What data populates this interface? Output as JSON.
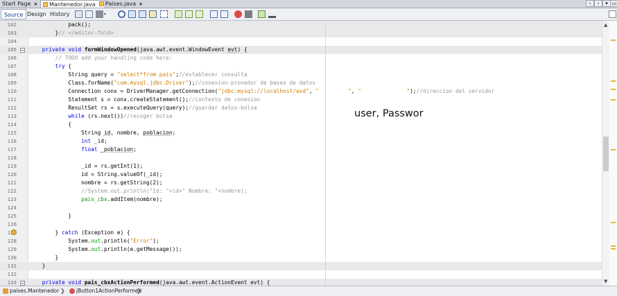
{
  "tabs": [
    {
      "label": "Start Page",
      "close": "×"
    },
    {
      "label": "Mantenedor.java",
      "close": "×"
    },
    {
      "label": "Paises.java",
      "close": "×"
    }
  ],
  "tab_nav": {
    "left": "‹",
    "right": "›",
    "menu": "▾",
    "restore": "▭"
  },
  "editor_tabs": {
    "source": "Source",
    "design": "Design",
    "history": "History"
  },
  "lines": [
    {
      "n": "102",
      "hl": true,
      "html": "            pack();"
    },
    {
      "n": "103",
      "hl": true,
      "html": "        }<span class=\"cm\">// &lt;/editor-fold&gt;</span>"
    },
    {
      "n": "104",
      "hl": false,
      "html": ""
    },
    {
      "n": "105",
      "hl": true,
      "fold": true,
      "html": "    <span class=\"kw\">private void</span> <span class=\"fn\">formWindowOpened</span>(java.awt.event.WindowEvent <span class=\"ul\">evt</span>) {"
    },
    {
      "n": "106",
      "hl": false,
      "html": "        <span class=\"cm\">// TODO add your handling code here:</span>"
    },
    {
      "n": "107",
      "hl": false,
      "html": "        <span class=\"kw\">try</span> {"
    },
    {
      "n": "108",
      "hl": false,
      "html": "            String query = <span class=\"str\">\"select*from pais\"</span>;<span class=\"cm\">//establecer consulta</span>"
    },
    {
      "n": "109",
      "hl": false,
      "html": "            Class.forName(<span class=\"str\">\"com.mysql.jdbc.Driver\"</span>);<span class=\"cm\">//conexion-provedor de bases de datos</span>"
    },
    {
      "n": "110",
      "hl": false,
      "html": "            Connection conx = DriverManager.getConnection(<span class=\"str\">\"jdbc:mysql://localhost/asd\"</span>, <span class=\"str\">\"         \"</span>, <span class=\"str\">\"              \"</span>);<span class=\"cm\">//direccion del servidor</span>"
    },
    {
      "n": "111",
      "hl": false,
      "html": "            Statement s = conx.createStatement();<span class=\"cm\">//contexto de conexion</span>"
    },
    {
      "n": "112",
      "hl": false,
      "html": "            ResultSet rs = s.executeQuery(query);<span class=\"cm\">//guardar datos-bolsa</span>"
    },
    {
      "n": "113",
      "hl": false,
      "html": "            <span class=\"kw\">while</span> (rs.next())<span class=\"cm\">//recoger bolsa</span>"
    },
    {
      "n": "114",
      "hl": false,
      "html": "            {"
    },
    {
      "n": "115",
      "hl": false,
      "html": "                String <span class=\"ul\">id</span>, nombre, <span class=\"ul\">poblacion</span>;"
    },
    {
      "n": "116",
      "hl": false,
      "html": "                <span class=\"kw\">int</span> _id;"
    },
    {
      "n": "117",
      "hl": false,
      "html": "                <span class=\"kw\">float</span> <span class=\"ul\">_poblacion</span>;"
    },
    {
      "n": "118",
      "hl": false,
      "html": ""
    },
    {
      "n": "119",
      "hl": false,
      "html": "                _id = rs.getInt(1);"
    },
    {
      "n": "120",
      "hl": false,
      "html": "                id = String.valueOf(_id);"
    },
    {
      "n": "121",
      "hl": false,
      "html": "                nombre = rs.getString(2);"
    },
    {
      "n": "122",
      "hl": false,
      "html": "                <span class=\"cm\">//System.out.println(\"Id: \"+id+\" Nombre: \"+nombre);</span>"
    },
    {
      "n": "123",
      "hl": false,
      "html": "                <span class=\"fld\">pais_cbx</span>.addItem(nombre);"
    },
    {
      "n": "124",
      "hl": false,
      "html": ""
    },
    {
      "n": "125",
      "hl": false,
      "html": "            }"
    },
    {
      "n": "126",
      "hl": false,
      "html": ""
    },
    {
      "n": "127",
      "hl": false,
      "warn": true,
      "html": "        } <span class=\"kw\">catch</span> (Exception e) {"
    },
    {
      "n": "128",
      "hl": false,
      "html": "            System.<span class=\"fld\">out</span>.println(<span class=\"str\">\"Error\"</span>);"
    },
    {
      "n": "129",
      "hl": false,
      "html": "            System.<span class=\"fld\">out</span>.println(e.getMessage());"
    },
    {
      "n": "130",
      "hl": false,
      "html": "        }"
    },
    {
      "n": "131",
      "hl": true,
      "html": "    }"
    },
    {
      "n": "132",
      "hl": false,
      "html": ""
    },
    {
      "n": "133",
      "hl": true,
      "fold": true,
      "html": "    <span class=\"kw\">private void</span> <span class=\"fn\">pais_cbxActionPerformed</span>(java.awt.event.ActionEvent evt) {"
    }
  ],
  "overlay_text": "user, Passwor",
  "breadcrumb": {
    "item1": "paises.Mantenedor",
    "item2": "jButton1ActionPerformed"
  },
  "colors": {
    "keyword": "#0000e6",
    "string": "#ce7b00",
    "comment": "#969696",
    "field": "#009900"
  }
}
